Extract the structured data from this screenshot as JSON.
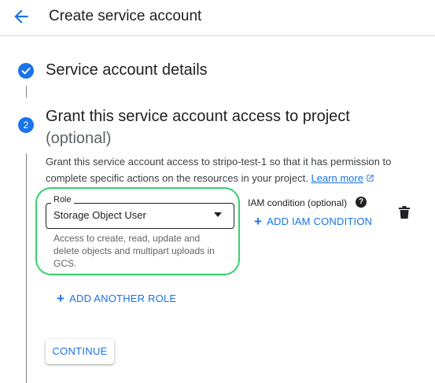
{
  "header": {
    "title": "Create service account",
    "back_icon": "arrow-left"
  },
  "steps": [
    {
      "number": "1",
      "title": "Service account details",
      "status": "complete",
      "icon": "check"
    },
    {
      "number": "2",
      "title": "Grant this service account access to project",
      "subtitle": "(optional)",
      "status": "active"
    }
  ],
  "grant": {
    "description": "Grant this service account access to stripo-test-1 so that it has permission to complete specific actions on the resources in your project.",
    "learn_more": "Learn more",
    "role": {
      "label": "Role",
      "value": "Storage Object User",
      "help": "Access to create, read, update and delete objects and multipart uploads in GCS."
    },
    "iam_condition_label": "IAM condition (optional)",
    "add_iam_condition": "ADD IAM CONDITION",
    "add_another_role": "ADD ANOTHER ROLE",
    "continue": "CONTINUE"
  },
  "colors": {
    "accent": "#1a73e8",
    "highlight": "#33d16e",
    "text": "#202124"
  }
}
